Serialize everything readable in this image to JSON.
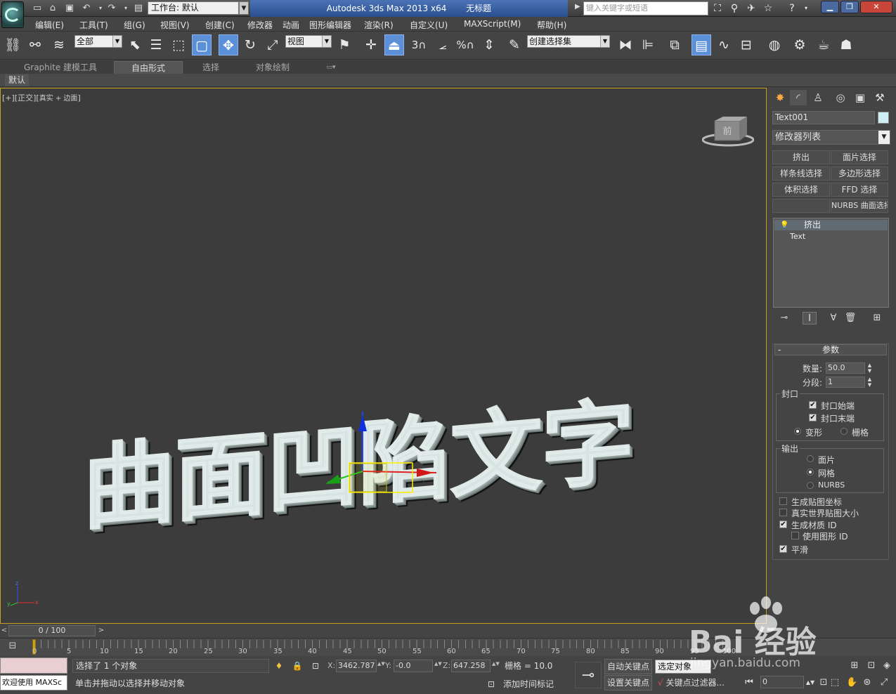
{
  "titlebar": {
    "workspace": "工作台: 默认",
    "app_title": "Autodesk 3ds Max  2013 x64",
    "doc_title": "无标题",
    "search_placeholder": "键入关键字或短语"
  },
  "menu": [
    "编辑(E)",
    "工具(T)",
    "组(G)",
    "视图(V)",
    "创建(C)",
    "修改器",
    "动画",
    "图形编辑器",
    "渲染(R)",
    "自定义(U)",
    "MAXScript(M)",
    "帮助(H)"
  ],
  "toolbar": {
    "selection_filter": "全部",
    "ref_coord": "视图",
    "named_selection": "创建选择集",
    "snap_3": "3",
    "snap_percent": "%"
  },
  "ribbon": {
    "tabs": [
      "Graphite 建模工具",
      "自由形式",
      "选择",
      "对象绘制"
    ],
    "sub_tab": "默认"
  },
  "viewport": {
    "label_main": "[+][正交][",
    "label_shading": "真实 + 边面",
    "label_end": "]",
    "scene_text": "曲面凹陷文字",
    "viewcube_face": "前"
  },
  "panel": {
    "object_name": "Text001",
    "modifier_list": "修改器列表",
    "mod_buttons": [
      "挤出",
      "面片选择",
      "样条线选择",
      "多边形选择",
      "体积选择",
      "FFD 选择",
      "",
      "NURBS 曲面选择"
    ],
    "stack_top": "挤出",
    "stack_base": "Text",
    "params_title": "参数",
    "amount_label": "数量:",
    "amount_value": "50.0",
    "segments_label": "分段:",
    "segments_value": "1",
    "capping_title": "封口",
    "cap_start": "封口始端",
    "cap_end": "封口末端",
    "morph": "变形",
    "grid": "栅格",
    "output_title": "输出",
    "out_patch": "面片",
    "out_mesh": "网格",
    "out_nurbs": "NURBS",
    "gen_mapping": "生成贴图坐标",
    "real_world": "真实世界贴图大小",
    "gen_matid": "生成材质 ID",
    "use_shape_id": "使用图形 ID",
    "smooth": "平滑"
  },
  "timeline": {
    "slider": "0 / 100",
    "ticks": [
      "0",
      "5",
      "10",
      "15",
      "20",
      "25",
      "30",
      "35",
      "40",
      "45",
      "50",
      "55",
      "60",
      "65",
      "70",
      "75",
      "80",
      "85",
      "90",
      "95",
      "100"
    ]
  },
  "status": {
    "maxs": "欢迎使用 MAXSc",
    "selected": "选择了 1 个对象",
    "prompt": "单击并拖动以选择并移动对象",
    "x_label": "X:",
    "x_value": "3462.787",
    "y_label": "Y:",
    "y_value": "-0.0",
    "z_label": "Z:",
    "z_value": "647.258",
    "grid": "栅格 = 10.0",
    "add_time_tag": "添加时间标记",
    "auto_key": "自动关键点",
    "set_key": "设置关键点",
    "selected_object": "选定对象",
    "key_filters": "关键点过滤器...",
    "frame": "0"
  },
  "watermark": {
    "brand": "Bai 经验",
    "url": "jingyan.baidu.com"
  },
  "colors": {
    "viewport_border": "#c79f1c",
    "title_blue": "#2a4f8e",
    "active_tool": "#5b8fd8",
    "extrude_text": "#d7e4e2"
  }
}
